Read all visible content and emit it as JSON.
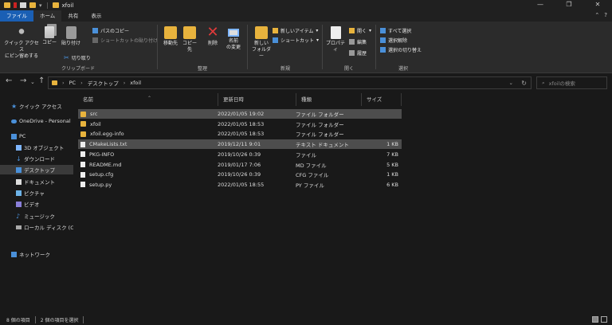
{
  "window": {
    "title": "xfoil",
    "controls": [
      "—",
      "❐",
      "✕"
    ]
  },
  "ribbon_tabs": [
    "ファイル",
    "ホーム",
    "共有",
    "表示"
  ],
  "ribbon": {
    "clipboard": {
      "quick_access_label_1": "クイック アクセス",
      "quick_access_label_2": "にピン留めする",
      "copy": "コピー",
      "paste": "貼り付け",
      "copy_path": "パスのコピー",
      "paste_shortcut": "ショートカットの貼り付け",
      "cut": "切り取り",
      "group": "クリップボード"
    },
    "organize": {
      "move_to": "移動先",
      "copy_to": "コピー先",
      "delete": "削除",
      "rename_1": "名前",
      "rename_2": "の変更",
      "group": "整理"
    },
    "new": {
      "new_folder_1": "新しい",
      "new_folder_2": "フォルダー",
      "new_item": "新しいアイテム",
      "shortcut": "ショートカット",
      "group": "新規"
    },
    "open": {
      "properties": "プロパティ",
      "open": "開く",
      "edit": "編集",
      "history": "履歴",
      "group": "開く"
    },
    "select": {
      "select_all": "すべて選択",
      "select_none": "選択解除",
      "invert": "選択の切り替え",
      "group": "選択"
    }
  },
  "address": {
    "crumbs": [
      "PC",
      "デスクトップ",
      "xfoil"
    ],
    "search_placeholder": "xfoilの検索"
  },
  "sidebar": {
    "items": [
      {
        "label": "クイック アクセス",
        "icon": "star-icon"
      },
      {
        "label": "OneDrive - Personal",
        "icon": "cloud-icon"
      },
      {
        "label": "PC",
        "icon": "computer-icon"
      },
      {
        "label": "3D オブジェクト",
        "icon": "cube-icon"
      },
      {
        "label": "ダウンロード",
        "icon": "download-icon"
      },
      {
        "label": "デスクトップ",
        "icon": "desktop-icon"
      },
      {
        "label": "ドキュメント",
        "icon": "document-icon"
      },
      {
        "label": "ピクチャ",
        "icon": "picture-icon"
      },
      {
        "label": "ビデオ",
        "icon": "video-icon"
      },
      {
        "label": "ミュージック",
        "icon": "music-icon"
      },
      {
        "label": "ローカル ディスク (C:)",
        "icon": "disk-icon"
      },
      {
        "label": "ネットワーク",
        "icon": "network-icon"
      }
    ]
  },
  "columns": {
    "name": "名前",
    "date": "更新日時",
    "type": "種類",
    "size": "サイズ"
  },
  "files": [
    {
      "name": "src",
      "date": "2022/01/05 19:02",
      "type": "ファイル フォルダー",
      "size": "",
      "kind": "folder",
      "selected": true
    },
    {
      "name": "xfoil",
      "date": "2022/01/05 18:53",
      "type": "ファイル フォルダー",
      "size": "",
      "kind": "folder",
      "selected": false
    },
    {
      "name": "xfoil.egg-info",
      "date": "2022/01/05 18:53",
      "type": "ファイル フォルダー",
      "size": "",
      "kind": "folder",
      "selected": false
    },
    {
      "name": "CMakeLists.txt",
      "date": "2019/12/11 9:01",
      "type": "テキスト ドキュメント",
      "size": "1 KB",
      "kind": "file",
      "selected": true
    },
    {
      "name": "PKG-INFO",
      "date": "2019/10/26 0:39",
      "type": "ファイル",
      "size": "7 KB",
      "kind": "file",
      "selected": false
    },
    {
      "name": "README.md",
      "date": "2019/01/17 7:06",
      "type": "MD ファイル",
      "size": "5 KB",
      "kind": "file",
      "selected": false
    },
    {
      "name": "setup.cfg",
      "date": "2019/10/26 0:39",
      "type": "CFG ファイル",
      "size": "1 KB",
      "kind": "file",
      "selected": false
    },
    {
      "name": "setup.py",
      "date": "2022/01/05 18:55",
      "type": "PY ファイル",
      "size": "6 KB",
      "kind": "file",
      "selected": false
    }
  ],
  "status": {
    "item_count": "8 個の項目",
    "selected_count": "2 個の項目を選択"
  },
  "colors": {
    "accent": "#1a5fb4",
    "folder": "#e8b33d",
    "selection": "#4d4d4d",
    "background": "#191919"
  }
}
